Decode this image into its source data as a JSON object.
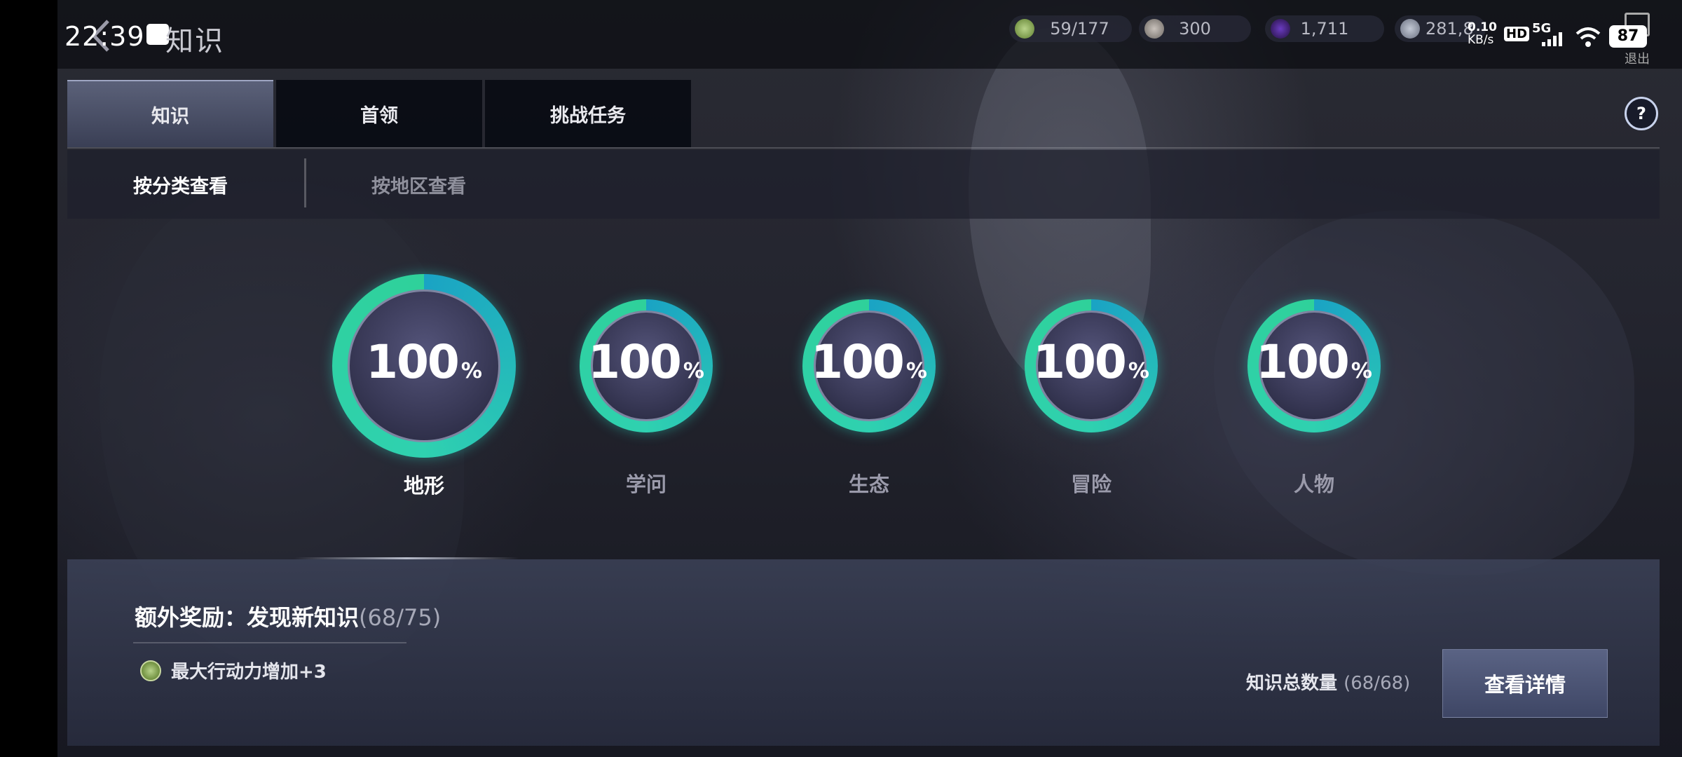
{
  "status_bar": {
    "time": "22:39",
    "net_speed": "0.10",
    "net_unit": "KB/s",
    "hd": "HD",
    "signal": "5G",
    "battery": "87"
  },
  "header": {
    "title": "知识",
    "exit_label": "退出"
  },
  "resources": [
    {
      "icon": "energy-icon",
      "value": "59/177",
      "color": "#8fb04f"
    },
    {
      "icon": "silver-orb-icon",
      "value": "300",
      "color": "#8f8a86"
    },
    {
      "icon": "purple-orb-icon",
      "value": "1,711",
      "color": "#5a2ea0"
    },
    {
      "icon": "coin-icon",
      "value": "281,8",
      "color": "#9aa2b0"
    }
  ],
  "tabs": [
    {
      "label": "知识",
      "active": true
    },
    {
      "label": "首领",
      "active": false
    },
    {
      "label": "挑战任务",
      "active": false
    }
  ],
  "subtabs": [
    {
      "label": "按分类查看",
      "active": true
    },
    {
      "label": "按地区查看",
      "active": false
    }
  ],
  "categories": [
    {
      "label": "地形",
      "percent": "100",
      "progress": 1.0,
      "active": true
    },
    {
      "label": "学问",
      "percent": "100",
      "progress": 1.0,
      "active": false
    },
    {
      "label": "生态",
      "percent": "100",
      "progress": 1.0,
      "active": false
    },
    {
      "label": "冒险",
      "percent": "100",
      "progress": 1.0,
      "active": false
    },
    {
      "label": "人物",
      "percent": "100",
      "progress": 1.0,
      "active": false
    }
  ],
  "percent_sign": "%",
  "bonus": {
    "title": "额外奖励：发现新知识",
    "count": "(68/75)",
    "reward_text": "最大行动力增加+3"
  },
  "total": {
    "label": "知识总数量",
    "count": "(68/68)"
  },
  "detail_button": "查看详情",
  "help_symbol": "?"
}
